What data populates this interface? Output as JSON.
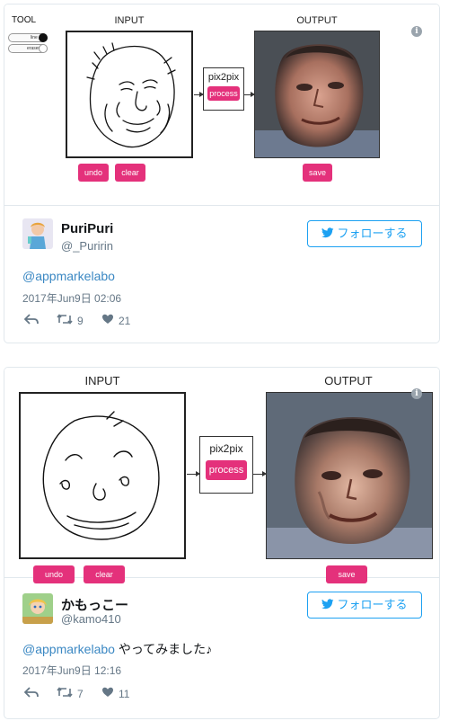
{
  "tweets": [
    {
      "media": {
        "tool_label": "TOOL",
        "tool_options": [
          "line",
          "eraser"
        ],
        "input_label": "INPUT",
        "output_label": "OUTPUT",
        "model_label": "pix2pix",
        "process_label": "process",
        "undo_label": "undo",
        "clear_label": "clear",
        "save_label": "save"
      },
      "user": {
        "name": "PuriPuri",
        "handle": "@_Puririn"
      },
      "follow_label": "フォローする",
      "mention": "@appmarkelabo",
      "body": "",
      "date": "2017年Jun9日 02:06",
      "retweets": "9",
      "likes": "21"
    },
    {
      "media": {
        "input_label": "INPUT",
        "output_label": "OUTPUT",
        "model_label": "pix2pix",
        "process_label": "process",
        "undo_label": "undo",
        "clear_label": "clear",
        "save_label": "save"
      },
      "user": {
        "name": "かもっこー",
        "handle": "@kamo410"
      },
      "follow_label": "フォローする",
      "mention": "@appmarkelabo",
      "body": " やってみました♪",
      "date": "2017年Jun9日 12:16",
      "retweets": "7",
      "likes": "11"
    }
  ],
  "colors": {
    "accent_pink": "#e4317b",
    "twitter_blue": "#1da1f2",
    "mention_blue": "#3b88c3",
    "muted": "#657786"
  }
}
